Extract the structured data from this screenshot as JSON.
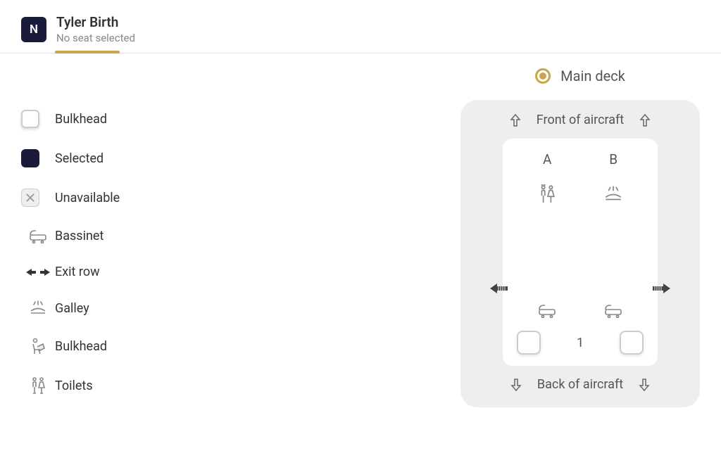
{
  "passenger": {
    "initial": "N",
    "name": "Tyler Birth",
    "status": "No seat selected"
  },
  "legend": {
    "bulkhead": "Bulkhead",
    "selected": "Selected",
    "unavailable": "Unavailable",
    "bassinet": "Bassinet",
    "exit_row": "Exit row",
    "galley": "Galley",
    "bulkhead_seat": "Bulkhead",
    "toilets": "Toilets"
  },
  "deck": {
    "label": "Main deck"
  },
  "seatmap": {
    "front_label": "Front of aircraft",
    "back_label": "Back of aircraft",
    "columns": [
      "A",
      "B"
    ],
    "row_number": "1"
  }
}
